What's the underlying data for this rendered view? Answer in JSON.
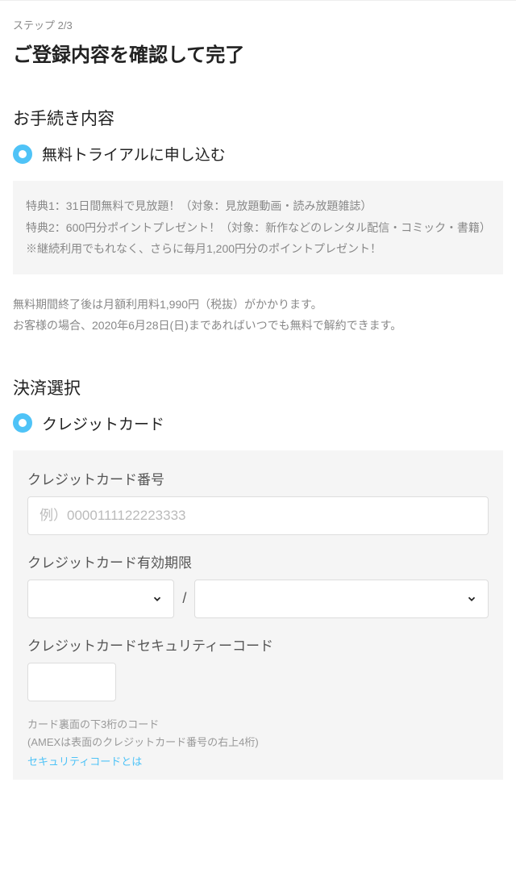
{
  "step": "ステップ 2/3",
  "title": "ご登録内容を確認して完了",
  "procedure": {
    "heading": "お手続き内容",
    "option_label": "無料トライアルに申し込む",
    "info1": "特典1：31日間無料で見放題！（対象：見放題動画・読み放題雑誌）",
    "info2": "特典2：600円分ポイントプレゼント！（対象：新作などのレンタル配信・コミック・書籍）",
    "info3": "※継続利用でもれなく、さらに毎月1,200円分のポイントプレゼント！",
    "note1": "無料期間終了後は月額利用料1,990円（税抜）がかかります。",
    "note2": "お客様の場合、2020年6月28日(日)まであればいつでも無料で解約できます。"
  },
  "payment": {
    "heading": "決済選択",
    "option_label": "クレジットカード",
    "card_number_label": "クレジットカード番号",
    "card_number_placeholder": "例）0000111122223333",
    "expiry_label": "クレジットカード有効期限",
    "cvv_label": "クレジットカードセキュリティーコード",
    "hint1": "カード裏面の下3桁のコード",
    "hint2": "(AMEXは表面のクレジットカード番号の右上4桁)",
    "link": "セキュリティコードとは"
  }
}
